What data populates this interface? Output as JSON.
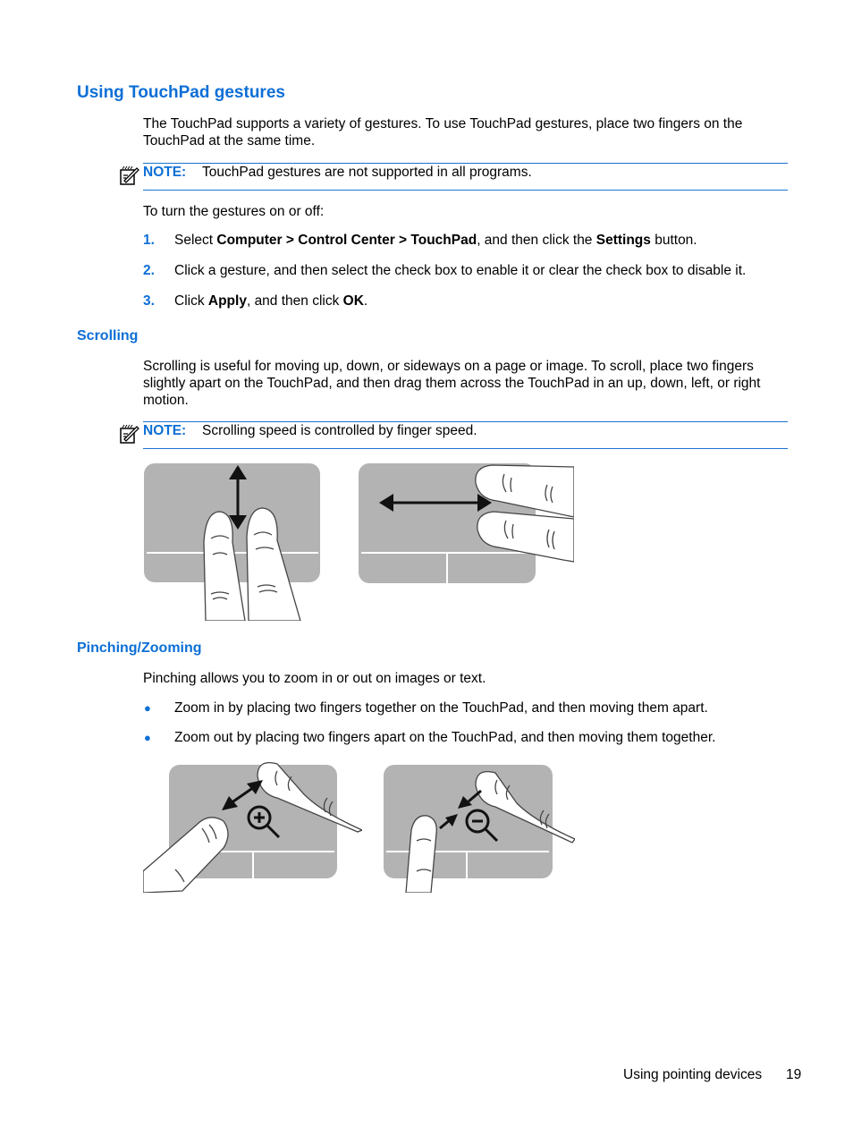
{
  "page": {
    "heading": "Using TouchPad gestures",
    "intro": "The TouchPad supports a variety of gestures. To use TouchPad gestures, place two fingers on the TouchPad at the same time.",
    "note1": {
      "label": "NOTE:",
      "text": "TouchPad gestures are not supported in all programs.",
      "icon": "note-pencil-icon"
    },
    "toggle_intro": "To turn the gestures on or off:",
    "steps": [
      {
        "num": "1.",
        "parts": [
          {
            "t": "Select ",
            "b": false
          },
          {
            "t": "Computer > Control Center > TouchPad",
            "b": true
          },
          {
            "t": ", and then click the ",
            "b": false
          },
          {
            "t": "Settings",
            "b": true
          },
          {
            "t": " button.",
            "b": false
          }
        ]
      },
      {
        "num": "2.",
        "parts": [
          {
            "t": "Click a gesture, and then select the check box to enable it or clear the check box to disable it.",
            "b": false
          }
        ]
      },
      {
        "num": "3.",
        "parts": [
          {
            "t": "Click ",
            "b": false
          },
          {
            "t": "Apply",
            "b": true
          },
          {
            "t": ", and then click ",
            "b": false
          },
          {
            "t": "OK",
            "b": true
          },
          {
            "t": ".",
            "b": false
          }
        ]
      }
    ],
    "scrolling": {
      "heading": "Scrolling",
      "text": "Scrolling is useful for moving up, down, or sideways on a page or image. To scroll, place two fingers slightly apart on the TouchPad, and then drag them across the TouchPad in an up, down, left, or right motion.",
      "note": {
        "label": "NOTE:",
        "text": "Scrolling speed is controlled by finger speed."
      },
      "figures": [
        "vertical-scroll-illustration",
        "horizontal-scroll-illustration"
      ]
    },
    "pinching": {
      "heading": "Pinching/Zooming",
      "text": "Pinching allows you to zoom in or out on images or text.",
      "bullets": [
        "Zoom in by placing two fingers together on the TouchPad, and then moving them apart.",
        "Zoom out by placing two fingers apart on the TouchPad, and then moving them together."
      ],
      "figures": [
        "zoom-in-illustration",
        "zoom-out-illustration"
      ]
    },
    "footer": {
      "section": "Using pointing devices",
      "page_number": "19"
    }
  },
  "colors": {
    "accent": "#0d6fd6",
    "touchpad": "#b3b3b3",
    "rule": "#1a73d0"
  }
}
